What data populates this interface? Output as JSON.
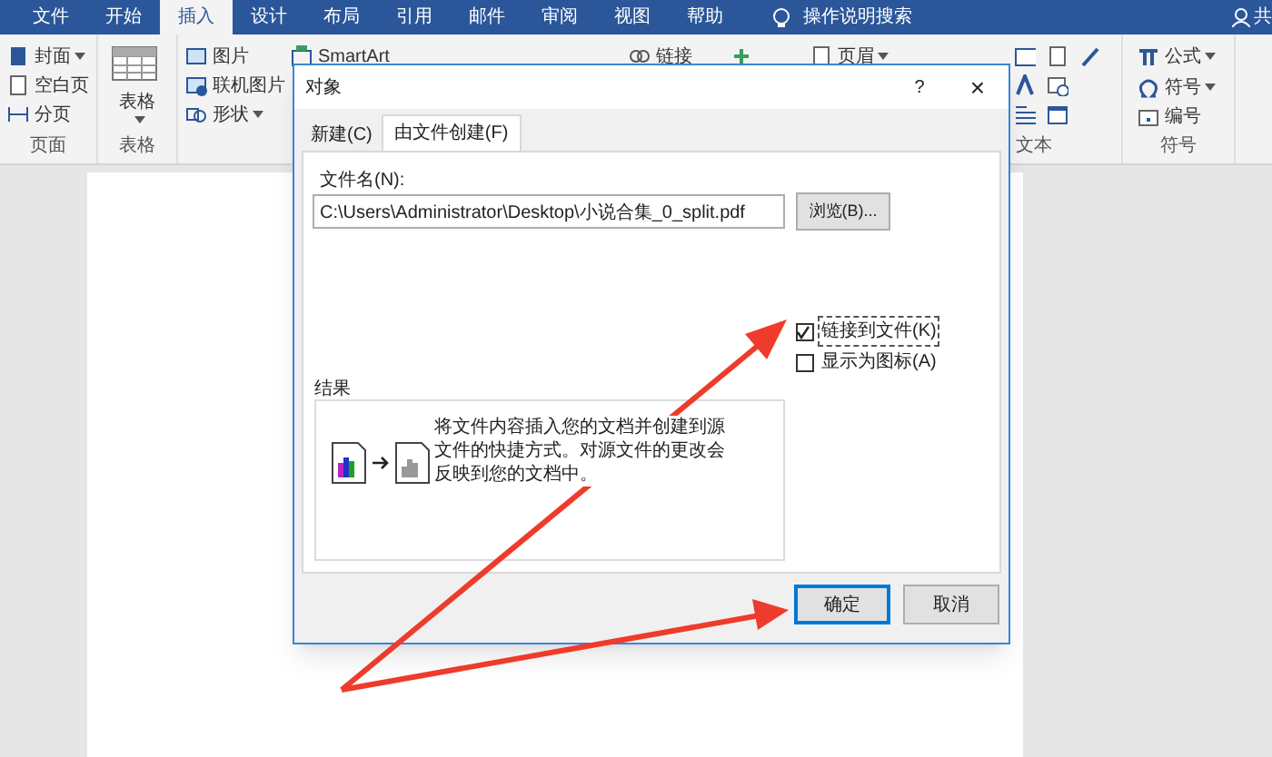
{
  "menu_tabs": [
    {
      "label": "文件",
      "selected": false
    },
    {
      "label": "开始",
      "selected": false
    },
    {
      "label": "插入",
      "selected": true
    },
    {
      "label": "设计",
      "selected": false
    },
    {
      "label": "布局",
      "selected": false
    },
    {
      "label": "引用",
      "selected": false
    },
    {
      "label": "邮件",
      "selected": false
    },
    {
      "label": "审阅",
      "selected": false
    },
    {
      "label": "视图",
      "selected": false
    },
    {
      "label": "帮助",
      "selected": false
    }
  ],
  "tell_me": "操作说明搜索",
  "share": "共",
  "ribbon": {
    "pages_group": {
      "label": "页面",
      "items": [
        {
          "label": "封面",
          "dropdown": true
        },
        {
          "label": "空白页",
          "dropdown": false
        },
        {
          "label": "分页",
          "dropdown": false
        }
      ]
    },
    "table_group": {
      "label": "表格",
      "button": "表格"
    },
    "illustrations": [
      {
        "label": "图片",
        "dropdown": false
      },
      {
        "label": "联机图片",
        "dropdown": false
      },
      {
        "label": "形状",
        "dropdown": true
      }
    ],
    "top_row": [
      {
        "label": "SmartArt"
      },
      {
        "label": "链接"
      },
      {
        "label": "页眉"
      }
    ],
    "text_group": {
      "label": "文本"
    },
    "symbols_group": {
      "label": "符号",
      "items": [
        {
          "label": "公式",
          "dropdown": true
        },
        {
          "label": "符号",
          "dropdown": true
        },
        {
          "label": "编号",
          "dropdown": false
        }
      ]
    }
  },
  "dialog": {
    "title": "对象",
    "help": "?",
    "close": "×",
    "tabs": [
      {
        "label": "新建(C)",
        "selected": false
      },
      {
        "label": "由文件创建(F)",
        "selected": true
      }
    ],
    "file_name_label": "文件名(N):",
    "file_name": "C:\\Users\\Administrator\\Desktop\\小说合集_0_split.pdf",
    "browse": "浏览(B)...",
    "options": [
      {
        "label": "链接到文件(K)",
        "checked": true,
        "focused": true
      },
      {
        "label": "显示为图标(A)",
        "checked": false,
        "focused": false
      }
    ],
    "result_label": "结果",
    "result_text": "将文件内容插入您的文档并创建到源文件的快捷方式。对源文件的更改会反映到您的文档中。",
    "buttons": [
      {
        "label": "确定",
        "default": true
      },
      {
        "label": "取消",
        "default": false
      }
    ]
  }
}
